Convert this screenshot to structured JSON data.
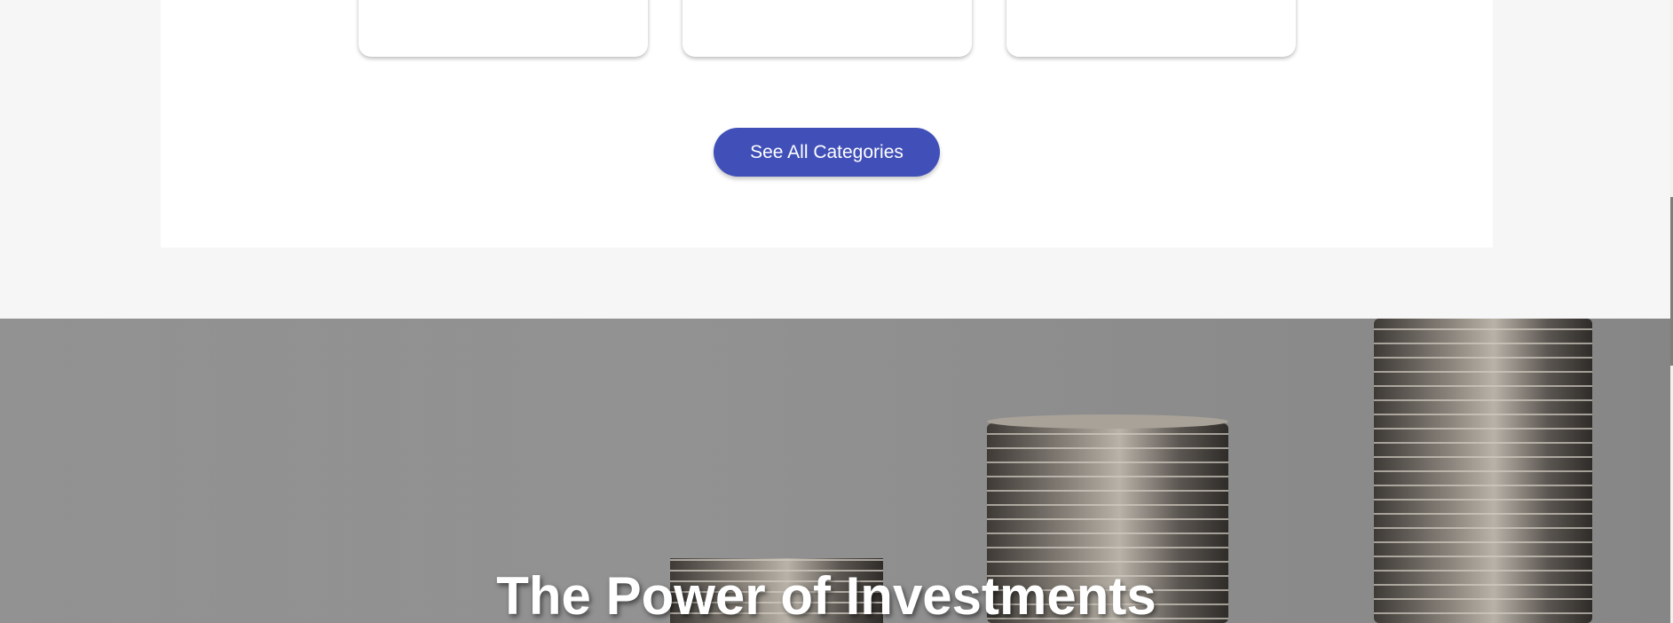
{
  "categories_section": {
    "see_all_label": "See All Categories"
  },
  "hero": {
    "title": "The Power of Investments",
    "image_icon": "coin-stacks-image"
  },
  "colors": {
    "button": "#4150b8",
    "page_background": "#f6f6f6",
    "hero_background": "#8f8f8f"
  }
}
